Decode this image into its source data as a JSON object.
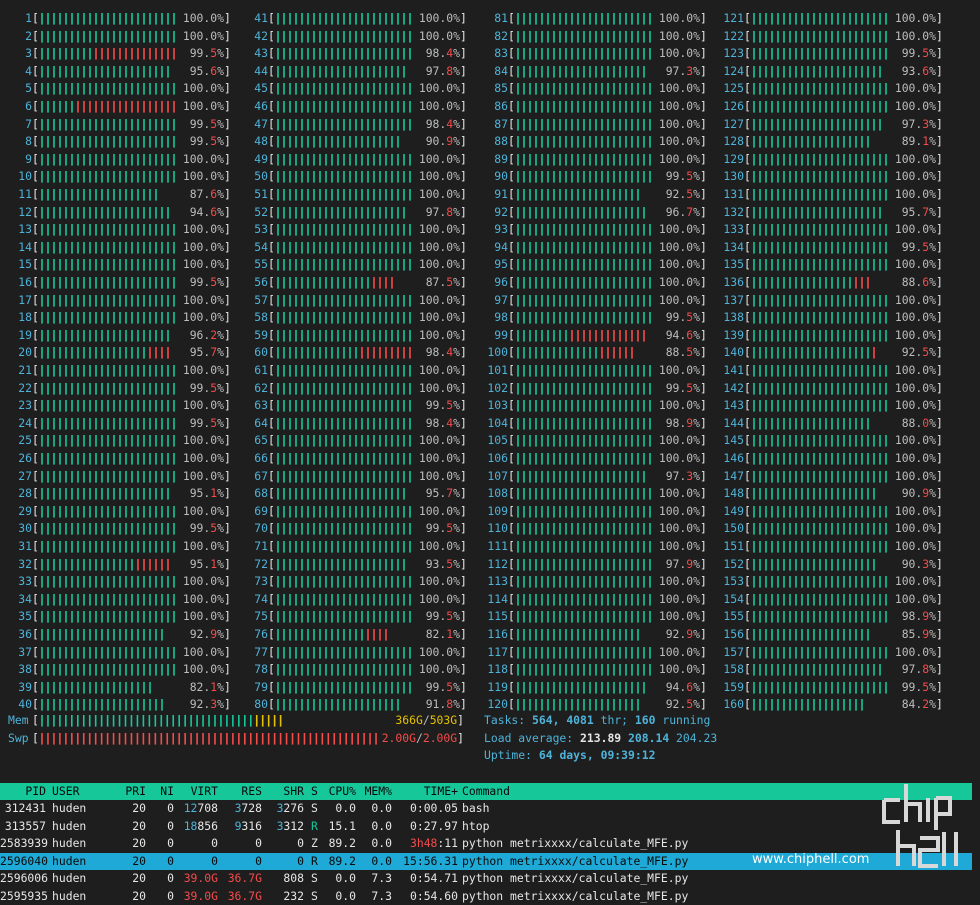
{
  "cpu_columns": [
    {
      "start": 1,
      "values": [
        "100.0",
        "100.0",
        "99.5",
        "95.6",
        "100.0",
        "100.0",
        "99.5",
        "99.5",
        "100.0",
        "100.0",
        "87.6",
        "94.6",
        "100.0",
        "100.0",
        "100.0",
        "99.5",
        "100.0",
        "100.0",
        "96.2",
        "95.7",
        "100.0",
        "99.5",
        "100.0",
        "99.5",
        "100.0",
        "100.0",
        "100.0",
        "95.1",
        "100.0",
        "99.5",
        "100.0",
        "95.1",
        "100.0",
        "100.0",
        "100.0",
        "92.9",
        "100.0",
        "100.0",
        "82.1",
        "92.3"
      ],
      "red": [
        0,
        0,
        14,
        0,
        0,
        17,
        0,
        0,
        0,
        0,
        0,
        0,
        0,
        0,
        0,
        0,
        0,
        0,
        0,
        4,
        0,
        0,
        0,
        0,
        0,
        0,
        0,
        0,
        0,
        0,
        0,
        6,
        0,
        0,
        0,
        0,
        0,
        0,
        0,
        0
      ]
    },
    {
      "start": 41,
      "values": [
        "100.0",
        "100.0",
        "98.4",
        "97.8",
        "100.0",
        "100.0",
        "98.4",
        "90.9",
        "100.0",
        "100.0",
        "100.0",
        "97.8",
        "100.0",
        "100.0",
        "100.0",
        "87.5",
        "100.0",
        "100.0",
        "100.0",
        "98.4",
        "100.0",
        "100.0",
        "99.5",
        "98.4",
        "100.0",
        "100.0",
        "100.0",
        "95.7",
        "100.0",
        "99.5",
        "100.0",
        "93.5",
        "100.0",
        "100.0",
        "99.5",
        "82.1",
        "100.0",
        "100.0",
        "99.5",
        "91.8"
      ],
      "red": [
        0,
        0,
        0,
        0,
        0,
        0,
        0,
        0,
        0,
        0,
        0,
        0,
        0,
        0,
        0,
        4,
        0,
        0,
        0,
        9,
        0,
        0,
        0,
        0,
        0,
        0,
        0,
        0,
        0,
        0,
        0,
        0,
        0,
        0,
        0,
        4,
        0,
        0,
        0,
        0
      ]
    },
    {
      "start": 81,
      "values": [
        "100.0",
        "100.0",
        "100.0",
        "97.3",
        "100.0",
        "100.0",
        "100.0",
        "100.0",
        "100.0",
        "99.5",
        "92.5",
        "96.7",
        "100.0",
        "100.0",
        "100.0",
        "100.0",
        "100.0",
        "99.5",
        "94.6",
        "88.5",
        "100.0",
        "99.5",
        "100.0",
        "98.9",
        "100.0",
        "100.0",
        "97.3",
        "100.0",
        "100.0",
        "100.0",
        "100.0",
        "97.9",
        "100.0",
        "100.0",
        "100.0",
        "92.9",
        "100.0",
        "100.0",
        "94.6",
        "92.5"
      ],
      "red": [
        0,
        0,
        0,
        0,
        0,
        0,
        0,
        0,
        0,
        0,
        0,
        0,
        0,
        0,
        0,
        0,
        0,
        0,
        13,
        6,
        0,
        0,
        0,
        0,
        0,
        0,
        0,
        0,
        0,
        0,
        0,
        0,
        0,
        0,
        0,
        0,
        0,
        0,
        0,
        0
      ]
    },
    {
      "start": 121,
      "values": [
        "100.0",
        "100.0",
        "99.5",
        "93.6",
        "100.0",
        "100.0",
        "97.3",
        "89.1",
        "100.0",
        "100.0",
        "100.0",
        "95.7",
        "100.0",
        "99.5",
        "100.0",
        "88.6",
        "100.0",
        "100.0",
        "100.0",
        "92.5",
        "100.0",
        "100.0",
        "100.0",
        "88.0",
        "100.0",
        "100.0",
        "100.0",
        "90.9",
        "100.0",
        "100.0",
        "100.0",
        "90.3",
        "100.0",
        "100.0",
        "98.9",
        "85.9",
        "100.0",
        "97.8",
        "99.5",
        "84.2"
      ],
      "red": [
        0,
        0,
        0,
        0,
        0,
        0,
        0,
        0,
        0,
        0,
        0,
        0,
        0,
        0,
        0,
        3,
        0,
        0,
        0,
        1,
        0,
        0,
        0,
        0,
        0,
        0,
        0,
        0,
        0,
        0,
        0,
        0,
        0,
        0,
        0,
        0,
        0,
        0,
        0,
        0
      ]
    }
  ],
  "red_suffix_hint": "values rendered with trailing red digits when below 100",
  "mem": {
    "label": "Mem",
    "used": "366G",
    "total": "503G",
    "fill": 0.728
  },
  "swp": {
    "label": "Swp",
    "used": "2.00G",
    "total": "2.00G",
    "fill": 1.0
  },
  "tasks": {
    "label": "Tasks:",
    "count": "564,",
    "thr": "4081",
    "thr_label": "thr;",
    "running": "160",
    "running_label": "running"
  },
  "load": {
    "label": "Load average:",
    "v1": "213.89",
    "v2": "208.14",
    "v3": "204.23"
  },
  "uptime": {
    "label": "Uptime:",
    "value": "64 days, 09:39:12"
  },
  "proc_header": {
    "pid": "PID",
    "user": "USER",
    "pri": "PRI",
    "ni": "NI",
    "virt": "VIRT",
    "res": "RES",
    "shr": "SHR",
    "s": "S",
    "cpu": "CPU%",
    "mem": "MEM%",
    "time": "TIME+",
    "cmd": "Command"
  },
  "processes": [
    {
      "pid": "312431",
      "user": "huden",
      "pri": "20",
      "ni": "0",
      "virt": "12708",
      "res": "3728",
      "shr": "3276",
      "s": "S",
      "cpu": "0.0",
      "mem": "0.0",
      "time": "0:00.05",
      "cmd": "bash"
    },
    {
      "pid": "313557",
      "user": "huden",
      "pri": "20",
      "ni": "0",
      "virt": "18856",
      "res": "9316",
      "shr": "3312",
      "s": "R",
      "cpu": "15.1",
      "mem": "0.0",
      "time": "0:27.97",
      "cmd": "htop"
    },
    {
      "pid": "2583939",
      "user": "huden",
      "pri": "20",
      "ni": "0",
      "virt": "0",
      "res": "0",
      "shr": "0",
      "s": "Z",
      "cpu": "89.2",
      "mem": "0.0",
      "time": "3h48:11",
      "cmd": "python metrixxxx/calculate_MFE.py"
    },
    {
      "pid": "2596040",
      "user": "huden",
      "pri": "20",
      "ni": "0",
      "virt": "0",
      "res": "0",
      "shr": "0",
      "s": "R",
      "cpu": "89.2",
      "mem": "0.0",
      "time": "15:56.31",
      "cmd": "python metrixxxx/calculate_MFE.py"
    },
    {
      "pid": "2596006",
      "user": "huden",
      "pri": "20",
      "ni": "0",
      "virt": "39.0G",
      "res": "36.7G",
      "shr": "808",
      "s": "S",
      "cpu": "0.0",
      "mem": "7.3",
      "time": "0:54.71",
      "cmd": "python metrixxxx/calculate_MFE.py"
    },
    {
      "pid": "2595935",
      "user": "huden",
      "pri": "20",
      "ni": "0",
      "virt": "39.0G",
      "res": "36.7G",
      "shr": "232",
      "s": "S",
      "cpu": "0.0",
      "mem": "7.3",
      "time": "0:54.60",
      "cmd": "python metrixxxx/calculate_MFE.py"
    }
  ],
  "watermark": "www.chiphell.com",
  "colors": {
    "green": "#16c79a",
    "red": "#f44b4b",
    "cyan": "#4fb3d9",
    "yellow": "#e5c100",
    "select": "#1fa9d6"
  }
}
